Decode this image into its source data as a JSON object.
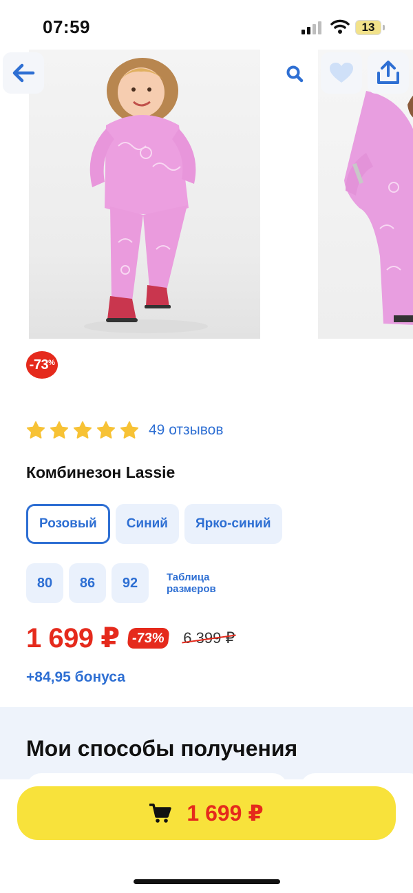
{
  "status_bar": {
    "time": "07:59",
    "battery": "13"
  },
  "header": {
    "back_icon": "arrow-left-icon",
    "search_icon": "search-icon",
    "favorite_icon": "heart-icon",
    "share_icon": "share-icon"
  },
  "product": {
    "discount_badge": "-73",
    "discount_percent_sign": "%",
    "rating": 5,
    "rating_max": 5,
    "reviews_label": "49 отзывов",
    "title": "Комбинезон Lassie",
    "colors": [
      {
        "label": "Розовый",
        "selected": true
      },
      {
        "label": "Синий",
        "selected": false
      },
      {
        "label": "Ярко-синий",
        "selected": false
      }
    ],
    "sizes": [
      "80",
      "86",
      "92"
    ],
    "size_table_label": "Таблица размеров",
    "price": "1 699 ₽",
    "price_discount": "-73%",
    "old_price": "6 399 ₽",
    "bonus": "+84,95 бонуса"
  },
  "delivery": {
    "title": "Мои способы получения"
  },
  "cart_button": {
    "icon": "cart-icon",
    "price": "1 699 ₽"
  },
  "colors": {
    "accent_blue": "#2e6fd3",
    "sale_red": "#e52a1c",
    "cta_yellow": "#f8e23b",
    "chip_bg": "#eaf1fc"
  }
}
